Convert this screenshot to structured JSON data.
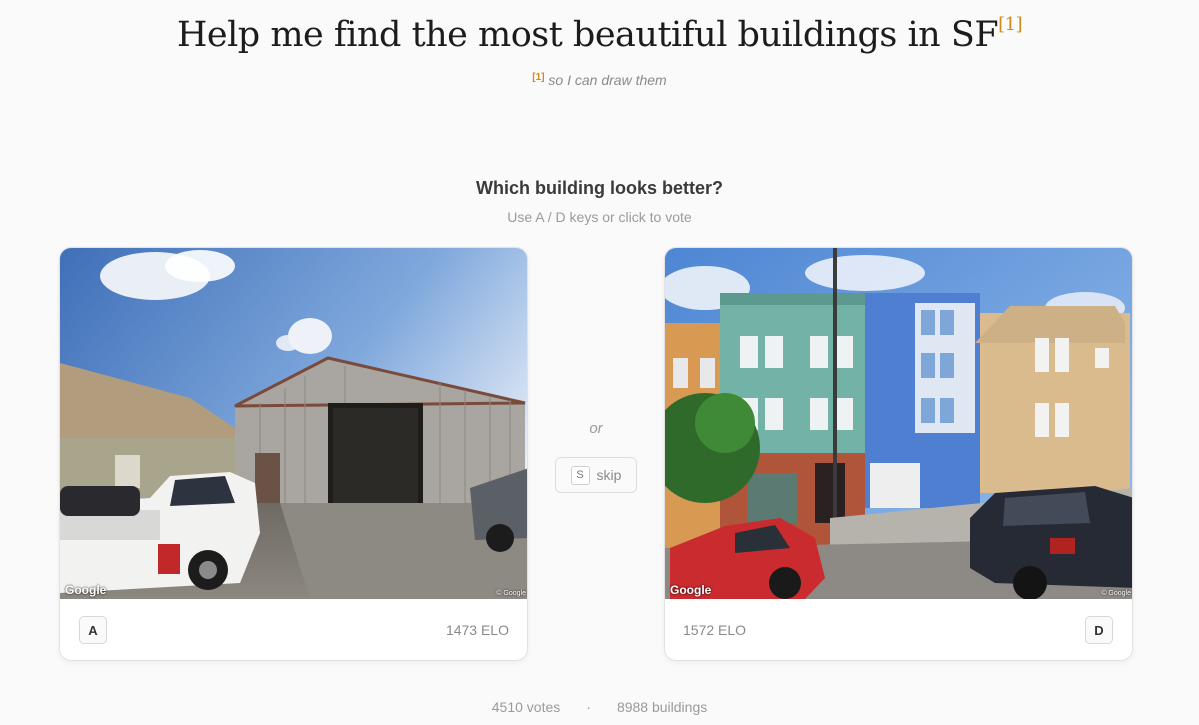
{
  "header": {
    "title": "Help me find the most beautiful buildings in SF",
    "footnote_mark": "[1]",
    "footnote_text": "so I can draw them"
  },
  "prompt": {
    "question": "Which building looks better?",
    "hint": "Use A / D keys or click to vote"
  },
  "cards": {
    "left": {
      "key": "A",
      "elo": "1473 ELO",
      "attribution": "Google",
      "copyright": "© Google"
    },
    "right": {
      "key": "D",
      "elo": "1572 ELO",
      "attribution": "Google",
      "copyright": "© Google"
    }
  },
  "middle": {
    "or_label": "or",
    "skip_key": "S",
    "skip_label": "skip"
  },
  "footer": {
    "votes": "4510 votes",
    "separator": "·",
    "buildings": "8988 buildings"
  }
}
